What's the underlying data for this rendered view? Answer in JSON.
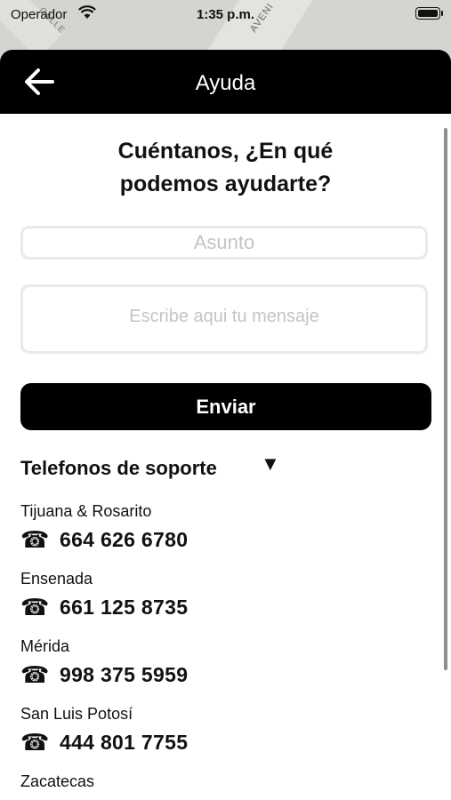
{
  "status_bar": {
    "carrier": "Operador",
    "time": "1:35 p.m."
  },
  "map": {
    "label_avenida": "AVENI",
    "label_calle": "CALLE"
  },
  "header": {
    "title": "Ayuda"
  },
  "form": {
    "heading_line1": "Cuéntanos, ¿En qué",
    "heading_line2": "podemos ayudarte?",
    "subject_placeholder": "Asunto",
    "message_placeholder": "Escribe aqui tu mensaje",
    "send_label": "Enviar"
  },
  "support": {
    "title": "Telefonos de soporte",
    "toggle_glyph": "▼",
    "phone_glyph": "☎",
    "items": [
      {
        "city": "Tijuana & Rosarito",
        "number": "664 626 6780"
      },
      {
        "city": "Ensenada",
        "number": "661 125 8735"
      },
      {
        "city": "Mérida",
        "number": "998 375 5959"
      },
      {
        "city": "San Luis Potosí",
        "number": "444 801 7755"
      },
      {
        "city": "Zacatecas",
        "number": ""
      }
    ]
  }
}
